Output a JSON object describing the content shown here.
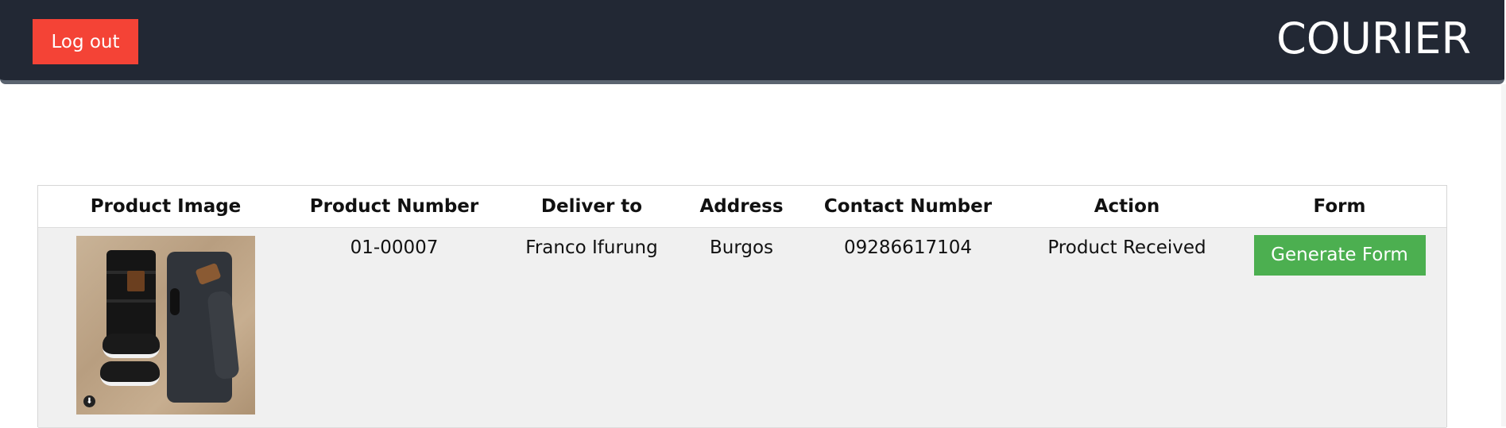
{
  "header": {
    "logout_label": "Log out",
    "brand": "COURIER"
  },
  "table": {
    "columns": [
      "Product Image",
      "Product Number",
      "Deliver to",
      "Address",
      "Contact Number",
      "Action",
      "Form"
    ],
    "rows": [
      {
        "product_number": "01-00007",
        "deliver_to": "Franco Ifurung",
        "address": "Burgos",
        "contact_number": "09286617104",
        "action": "Product Received",
        "form_button": "Generate Form"
      }
    ]
  },
  "colors": {
    "topbar": "#222834",
    "logout": "#f44336",
    "generate": "#4caf50",
    "row_bg": "#f0f0f0"
  }
}
